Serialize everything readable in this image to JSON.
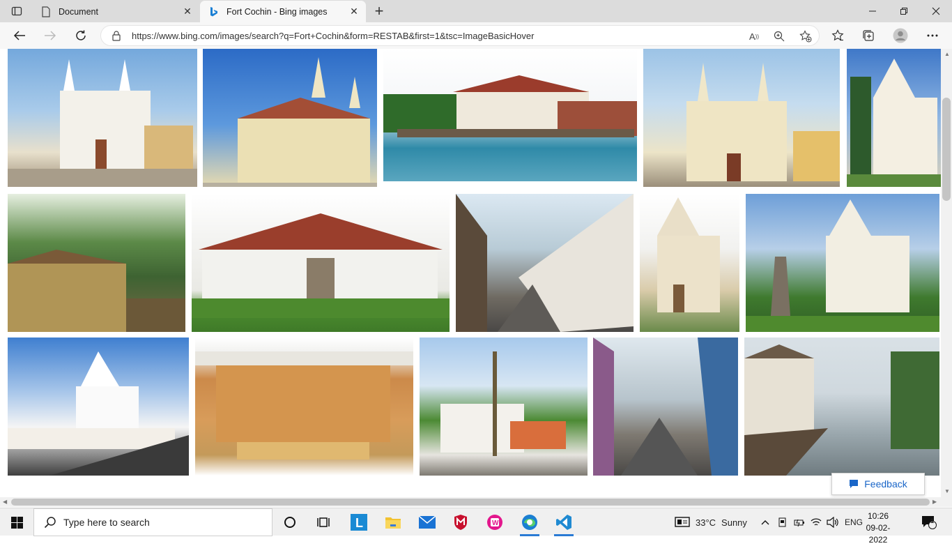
{
  "tabs": [
    {
      "title": "Document",
      "active": false
    },
    {
      "title": "Fort Cochin - Bing images",
      "active": true
    }
  ],
  "address": {
    "url": "https://www.bing.com/images/search?q=Fort+Cochin&form=RESTAB&first=1&tsc=ImageBasicHover"
  },
  "feedback": {
    "label": "Feedback"
  },
  "taskbar": {
    "search_placeholder": "Type here to search",
    "weather_temp": "33°C",
    "weather_text": "Sunny",
    "language": "ENG",
    "time": "10:26",
    "date": "09-02-2022",
    "notification_count": "1"
  },
  "colors": {
    "accent": "#1a66c8",
    "tabstrip": "#dcdcdc",
    "toolbar": "#f7f7f7"
  }
}
